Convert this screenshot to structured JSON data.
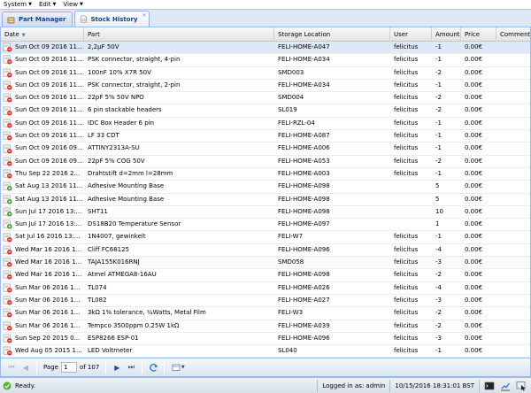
{
  "menu": [
    {
      "label": "System"
    },
    {
      "label": "Edit"
    },
    {
      "label": "View"
    }
  ],
  "tabs": [
    {
      "label": "Part Manager"
    },
    {
      "label": "Stock History",
      "close": "×"
    }
  ],
  "columns": {
    "date": "Date",
    "part": "Part",
    "location": "Storage Location",
    "user": "User",
    "amount": "Amount",
    "price": "Price",
    "comment": "Comment"
  },
  "rows": [
    {
      "type": "remove",
      "date": "Sun Oct 09 2016 11...",
      "part": "2,2µF 50V",
      "location": "FELI-HOME-A047",
      "user": "felicitus",
      "amount": "-1",
      "price": "0.00€",
      "comment": ""
    },
    {
      "type": "remove",
      "date": "Sun Oct 09 2016 11...",
      "part": "PSK connector, straight, 4-pin",
      "location": "FELI-HOME-A034",
      "user": "felicitus",
      "amount": "-1",
      "price": "0.00€",
      "comment": ""
    },
    {
      "type": "remove",
      "date": "Sun Oct 09 2016 11...",
      "part": "100nF 10% X7R 50V",
      "location": "SMD003",
      "user": "felicitus",
      "amount": "-2",
      "price": "0.00€",
      "comment": ""
    },
    {
      "type": "remove",
      "date": "Sun Oct 09 2016 11...",
      "part": "PSK connector, straight, 2-pin",
      "location": "FELI-HOME-A034",
      "user": "felicitus",
      "amount": "-1",
      "price": "0.00€",
      "comment": ""
    },
    {
      "type": "remove",
      "date": "Sun Oct 09 2016 11...",
      "part": "22pF 5% 50V NPO",
      "location": "SMD004",
      "user": "felicitus",
      "amount": "-2",
      "price": "0.00€",
      "comment": ""
    },
    {
      "type": "remove",
      "date": "Sun Oct 09 2016 11...",
      "part": "6 pin stackable headers",
      "location": "SL019",
      "user": "felicitus",
      "amount": "-2",
      "price": "0.00€",
      "comment": ""
    },
    {
      "type": "remove",
      "date": "Sun Oct 09 2016 11...",
      "part": "IDC Box Header 6 pin",
      "location": "FELI-RZL-04",
      "user": "felicitus",
      "amount": "-1",
      "price": "0.00€",
      "comment": ""
    },
    {
      "type": "remove",
      "date": "Sun Oct 09 2016 11...",
      "part": "LF 33 CDT",
      "location": "FELI-HOME-A087",
      "user": "felicitus",
      "amount": "-1",
      "price": "0.00€",
      "comment": ""
    },
    {
      "type": "remove",
      "date": "Sun Oct 09 2016 09...",
      "part": "ATTINY2313A-SU",
      "location": "FELI-HOME-A006",
      "user": "felicitus",
      "amount": "-1",
      "price": "0.00€",
      "comment": ""
    },
    {
      "type": "remove",
      "date": "Sun Oct 09 2016 09...",
      "part": "22pF 5% COG 50V",
      "location": "FELI-HOME-A053",
      "user": "felicitus",
      "amount": "-2",
      "price": "0.00€",
      "comment": ""
    },
    {
      "type": "remove",
      "date": "Thu Sep 22 2016 21...",
      "part": "Drahtstift d=2mm l=28mm",
      "location": "FELI-HOME-A003",
      "user": "felicitus",
      "amount": "-1",
      "price": "0.00€",
      "comment": ""
    },
    {
      "type": "add",
      "date": "Sat Aug 13 2016 11...",
      "part": "Adhesive Mounting Base",
      "location": "FELI-HOME-A098",
      "user": "",
      "amount": "5",
      "price": "0.00€",
      "comment": ""
    },
    {
      "type": "add",
      "date": "Sat Aug 13 2016 11...",
      "part": "Adhesive Mounting Base",
      "location": "FELI-HOME-A098",
      "user": "",
      "amount": "5",
      "price": "0.00€",
      "comment": ""
    },
    {
      "type": "add",
      "date": "Sun Jul 17 2016 13:...",
      "part": "SHT11",
      "location": "FELI-HOME-A098",
      "user": "",
      "amount": "10",
      "price": "0.00€",
      "comment": ""
    },
    {
      "type": "add",
      "date": "Sun Jul 17 2016 13:...",
      "part": "DS18B20 Temperature Sensor",
      "location": "FELI-HOME-A097",
      "user": "",
      "amount": "1",
      "price": "0.00€",
      "comment": ""
    },
    {
      "type": "remove",
      "date": "Sat Jul 16 2016 13:...",
      "part": "1N4007, gewinkelt",
      "location": "FELI-W7",
      "user": "felicitus",
      "amount": "-1",
      "price": "0.00€",
      "comment": ""
    },
    {
      "type": "remove",
      "date": "Wed Mar 16 2016 1...",
      "part": "Cliff FC68125",
      "location": "FELI-HOME-A096",
      "user": "felicitus",
      "amount": "-4",
      "price": "0.00€",
      "comment": ""
    },
    {
      "type": "remove",
      "date": "Wed Mar 16 2016 1...",
      "part": "TAJA155K016RNJ",
      "location": "SMD058",
      "user": "felicitus",
      "amount": "-3",
      "price": "0.00€",
      "comment": ""
    },
    {
      "type": "remove",
      "date": "Wed Mar 16 2016 1...",
      "part": "Atmel ATMEGA8-16AU",
      "location": "FELI-HOME-A098",
      "user": "felicitus",
      "amount": "-2",
      "price": "0.00€",
      "comment": ""
    },
    {
      "type": "remove",
      "date": "Sun Mar 06 2016 11...",
      "part": "TL074",
      "location": "FELI-HOME-A026",
      "user": "felicitus",
      "amount": "-4",
      "price": "0.00€",
      "comment": ""
    },
    {
      "type": "remove",
      "date": "Sun Mar 06 2016 11...",
      "part": "TL082",
      "location": "FELI-HOME-A027",
      "user": "felicitus",
      "amount": "-3",
      "price": "0.00€",
      "comment": ""
    },
    {
      "type": "remove",
      "date": "Sun Mar 06 2016 11...",
      "part": "3kΩ 1% tolerance, ¼Watts, Metal Film",
      "location": "FELI-W3",
      "user": "felicitus",
      "amount": "-2",
      "price": "0.00€",
      "comment": ""
    },
    {
      "type": "remove",
      "date": "Sun Mar 06 2016 11...",
      "part": "Tempco 3500ppm 0.25W 1kΩ",
      "location": "FELI-HOME-A039",
      "user": "felicitus",
      "amount": "-2",
      "price": "0.00€",
      "comment": ""
    },
    {
      "type": "remove",
      "date": "Sun Sep 20 2015 0...",
      "part": "ESP8266 ESP-01",
      "location": "FELI-HOME-A096",
      "user": "felicitus",
      "amount": "-3",
      "price": "0.00€",
      "comment": ""
    },
    {
      "type": "remove",
      "date": "Wed Aug 05 2015 1...",
      "part": "LED Voltmeter",
      "location": "SL040",
      "user": "felicitus",
      "amount": "-1",
      "price": "0.00€",
      "comment": ""
    }
  ],
  "pager": {
    "page_label": "Page",
    "page_value": "1",
    "of_label": "of 107"
  },
  "status": {
    "text": "Ready.",
    "logged_in": "Logged in as: admin",
    "datetime": "10/15/2016 18:31:01 BST"
  },
  "colors": {
    "accent": "#99bbe8",
    "selected_row": "#dfe8f6",
    "remove_icon": "#d9302c",
    "add_icon": "#3a9a2a"
  }
}
